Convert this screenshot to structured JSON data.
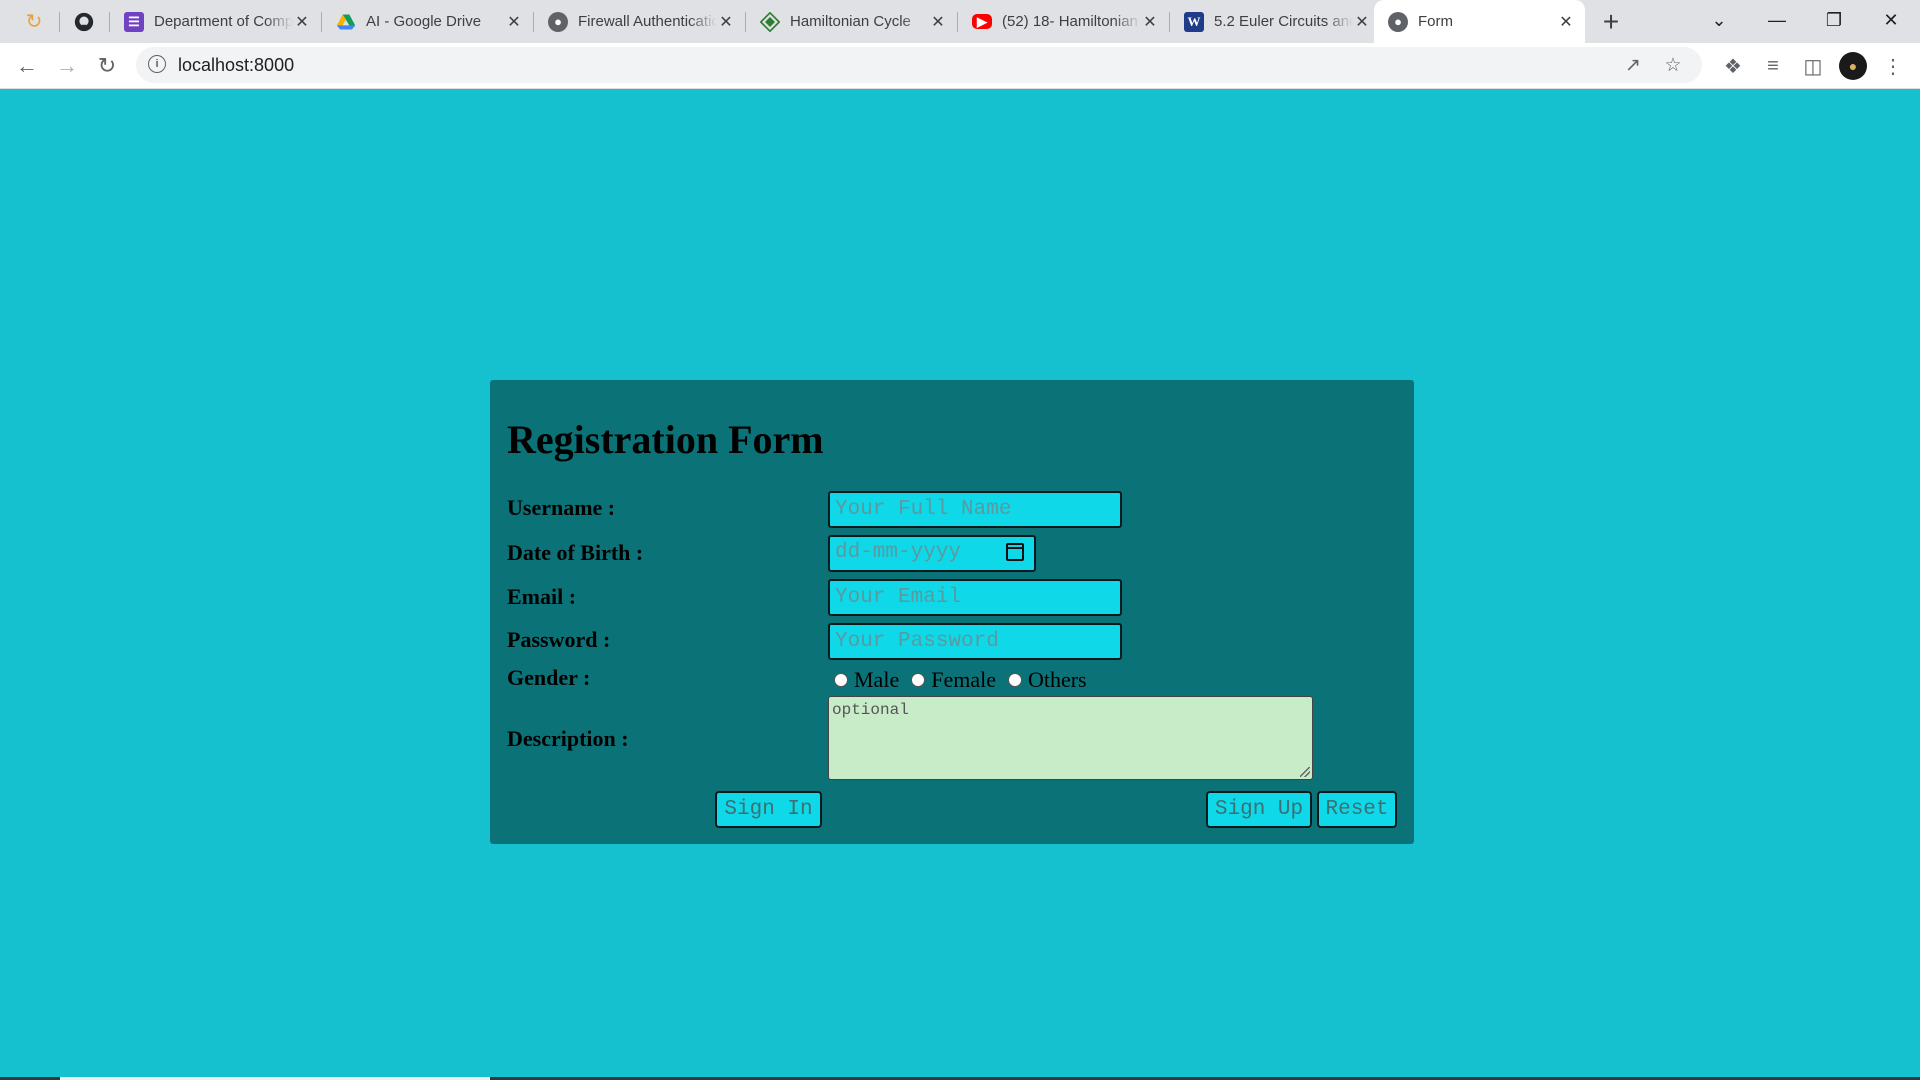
{
  "browser": {
    "pinned_tabs": [
      {
        "icon": "chrome-web-store-icon"
      },
      {
        "icon": "github-icon"
      }
    ],
    "tabs": [
      {
        "title": "Department of Computer",
        "icon": "document-list-icon",
        "color": "#6f42c1"
      },
      {
        "title": "AI - Google Drive",
        "icon": "google-drive-icon",
        "color": "#f4b400"
      },
      {
        "title": "Firewall Authentication",
        "icon": "globe-icon",
        "color": "#5f6368"
      },
      {
        "title": "Hamiltonian Cycle",
        "icon": "diamond-logo-icon",
        "color": "#2e7d32"
      },
      {
        "title": "(52) 18- Hamiltonian",
        "icon": "youtube-icon",
        "color": "#ff0000"
      },
      {
        "title": "5.2 Euler Circuits and",
        "icon": "word-icon",
        "color": "#1f3c88"
      },
      {
        "title": "Form",
        "icon": "globe-icon",
        "color": "#5f6368",
        "active": true
      }
    ],
    "url": "localhost:8000"
  },
  "form": {
    "title": "Registration Form",
    "username_label": "Username :",
    "username_placeholder": "Your Full Name",
    "dob_label": "Date of Birth :",
    "dob_placeholder": "dd-mm-yyyy",
    "email_label": "Email :",
    "email_placeholder": "Your Email",
    "password_label": "Password :",
    "password_placeholder": "Your Password",
    "gender_label": "Gender :",
    "gender_options": [
      "Male",
      "Female",
      "Others"
    ],
    "description_label": "Description :",
    "description_placeholder": "optional",
    "sign_in_label": "Sign In",
    "sign_up_label": "Sign Up",
    "reset_label": "Reset"
  },
  "colors": {
    "page_background": "#15c1cf",
    "card_background": "#0b7378",
    "input_background": "#0fd8e8",
    "textarea_background": "#c8ebc8"
  }
}
